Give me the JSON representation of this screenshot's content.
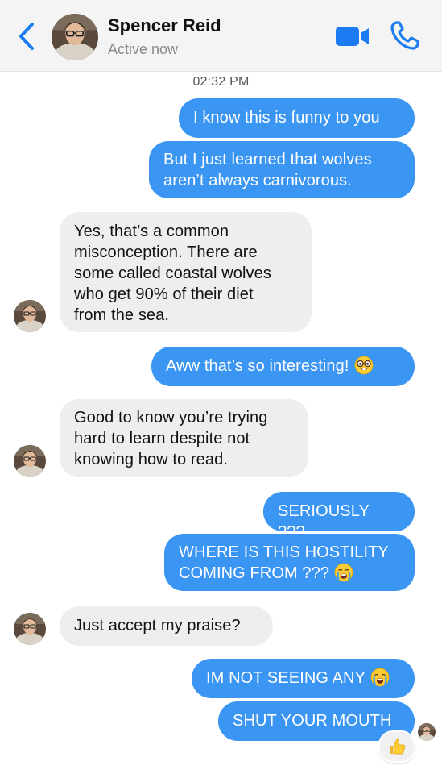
{
  "header": {
    "name": "Spencer Reid",
    "status": "Active now",
    "avatar_icon": "contact-avatar",
    "accent_color": "#1a7cf0"
  },
  "timestamp": "02:32 PM",
  "messages": [
    {
      "from": "me",
      "text": "I know this is funny to you"
    },
    {
      "from": "me",
      "lines": [
        "But I just learned that wolves",
        "aren’t always carnivorous."
      ]
    },
    {
      "from": "them",
      "lines": [
        "Yes, that’s a common",
        "misconception. There are",
        "some called coastal wolves",
        "who get 90% of their diet",
        "from the sea."
      ]
    },
    {
      "from": "me",
      "text": "Aww that’s so interesting!",
      "emoji": "nerd-face"
    },
    {
      "from": "them",
      "lines": [
        "Good to know you’re trying",
        "hard to learn despite not",
        "knowing how to read."
      ]
    },
    {
      "from": "me",
      "text": "SERIOUSLY ???"
    },
    {
      "from": "me",
      "lines": [
        "WHERE IS THIS HOSTILITY",
        "COMING FROM ???"
      ],
      "emoji": "crying-face"
    },
    {
      "from": "them",
      "text": "Just accept my praise?"
    },
    {
      "from": "me",
      "text": "IM NOT SEEING ANY",
      "emoji": "crying-face"
    },
    {
      "from": "me",
      "text": "SHUT YOUR MOUTH",
      "reaction": "thumbs-up"
    }
  ],
  "colors": {
    "outgoing_bubble": "#3b95f2",
    "incoming_bubble": "#eeeef0"
  }
}
